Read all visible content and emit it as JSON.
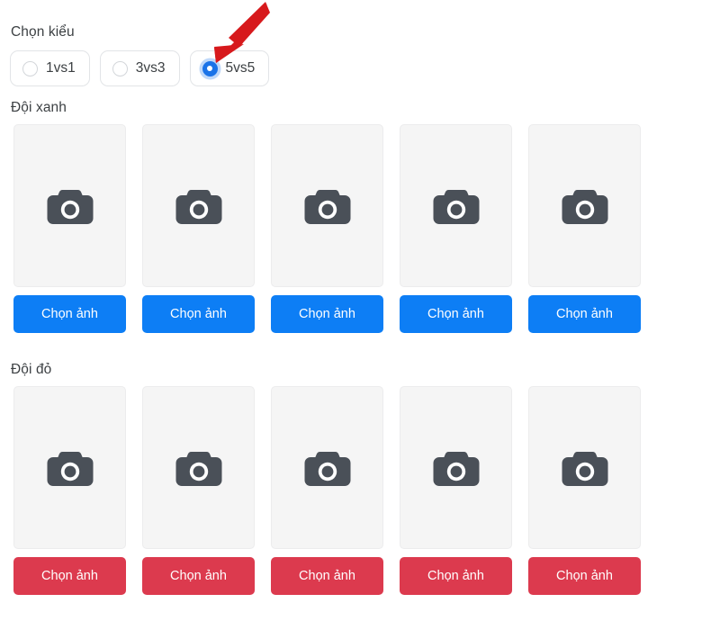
{
  "mode_section": {
    "label": "Chọn kiểu",
    "options": [
      {
        "value": "1vs1",
        "label": "1vs1",
        "selected": false
      },
      {
        "value": "3vs3",
        "label": "3vs3",
        "selected": false
      },
      {
        "value": "5vs5",
        "label": "5vs5",
        "selected": true
      }
    ]
  },
  "annotation": {
    "type": "arrow",
    "color": "#d7191c",
    "points_to": "5vs5",
    "direction": "down-left"
  },
  "teams": [
    {
      "id": "blue",
      "label": "Đội xanh",
      "button_color": "#0d7ef5",
      "slots": [
        {
          "placeholder_icon": "camera-icon",
          "button_label": "Chọn ảnh"
        },
        {
          "placeholder_icon": "camera-icon",
          "button_label": "Chọn ảnh"
        },
        {
          "placeholder_icon": "camera-icon",
          "button_label": "Chọn ảnh"
        },
        {
          "placeholder_icon": "camera-icon",
          "button_label": "Chọn ảnh"
        },
        {
          "placeholder_icon": "camera-icon",
          "button_label": "Chọn ảnh"
        }
      ]
    },
    {
      "id": "red",
      "label": "Đội đỏ",
      "button_color": "#dc3a4e",
      "slots": [
        {
          "placeholder_icon": "camera-icon",
          "button_label": "Chọn ảnh"
        },
        {
          "placeholder_icon": "camera-icon",
          "button_label": "Chọn ảnh"
        },
        {
          "placeholder_icon": "camera-icon",
          "button_label": "Chọn ảnh"
        },
        {
          "placeholder_icon": "camera-icon",
          "button_label": "Chọn ảnh"
        },
        {
          "placeholder_icon": "camera-icon",
          "button_label": "Chọn ảnh"
        }
      ]
    }
  ],
  "colors": {
    "accent_blue": "#1a73e8",
    "button_blue": "#0d7ef5",
    "button_red": "#dc3a4e",
    "card_bg": "#f5f5f5",
    "icon_gray": "#4a5058",
    "text": "#3c4043",
    "annotation_red": "#d7191c"
  }
}
